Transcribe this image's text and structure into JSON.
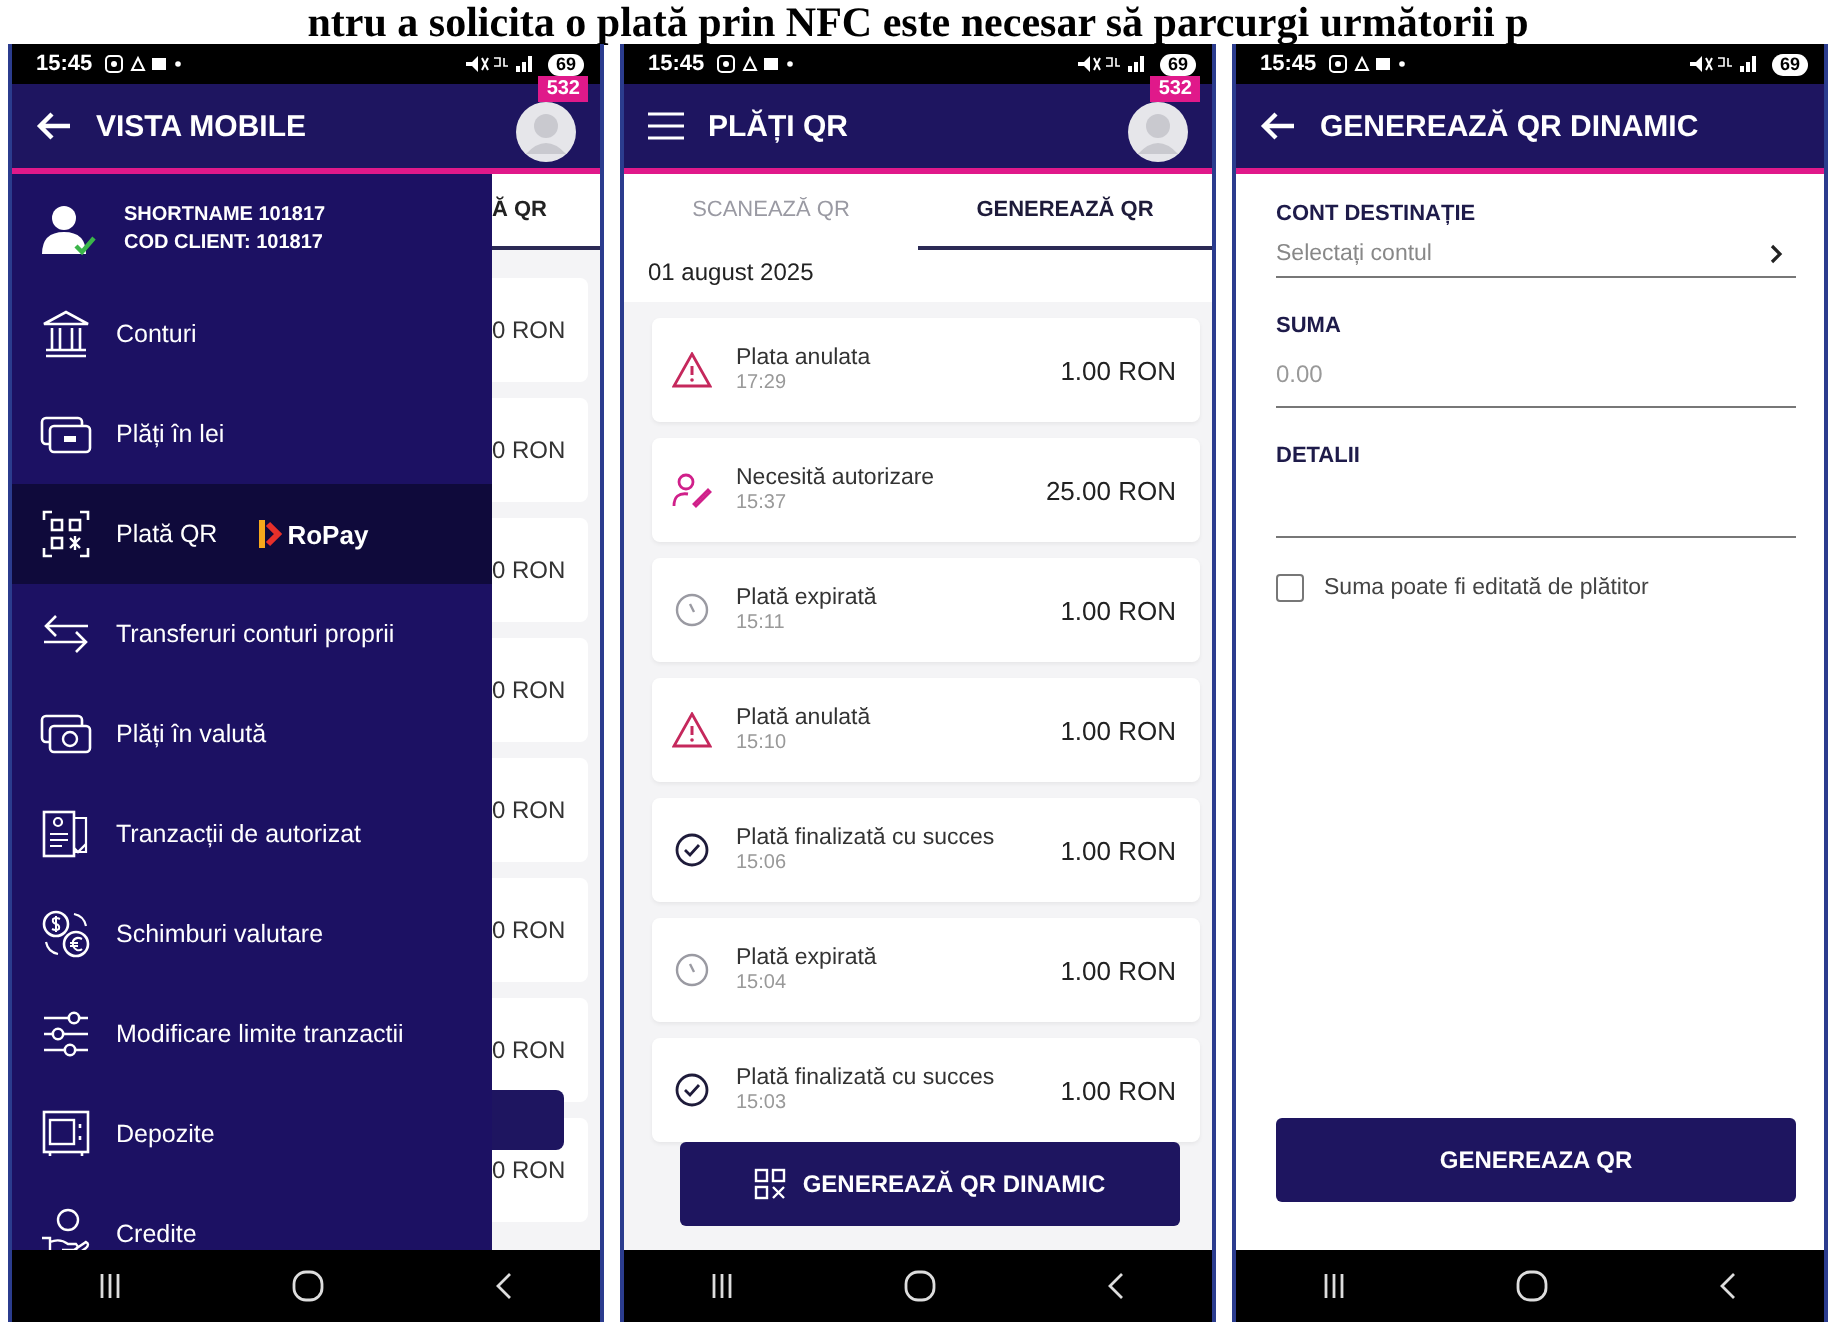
{
  "caption": "ntru a solicita o plată prin NFC este necesar să parcurgi următorii p",
  "screens": [
    {
      "kind": "drawer",
      "status_bar": {
        "time": "15:45",
        "battery": "69"
      },
      "header": {
        "kind": "back",
        "title": "VISTA MOBILE",
        "badge": "532"
      },
      "user": {
        "name": "SHORTNAME 101817",
        "client_code": "COD CLIENT: 101817"
      },
      "items": [
        {
          "kind": "bank",
          "label": "Conturi",
          "selected": false
        },
        {
          "kind": "cash",
          "label": "Plăți în lei",
          "selected": false
        },
        {
          "kind": "qr",
          "label": "Plată QR",
          "brand": "RoPay",
          "selected": true
        },
        {
          "kind": "transfer",
          "label": "Transferuri conturi proprii",
          "selected": false
        },
        {
          "kind": "currency",
          "label": "Plăți în valută",
          "selected": false
        },
        {
          "kind": "document",
          "label": "Tranzacții de autorizat",
          "selected": false
        },
        {
          "kind": "exchange",
          "label": "Schimburi valutare",
          "selected": false
        },
        {
          "kind": "sliders",
          "label": "Modificare limite tranzactii",
          "selected": false
        },
        {
          "kind": "safe",
          "label": "Depozite",
          "selected": false
        },
        {
          "kind": "hand",
          "label": "Credite",
          "selected": false
        }
      ],
      "background": {
        "tab": "Ă QR",
        "amounts": [
          "0 RON",
          "0 RON",
          "0 RON",
          "0 RON",
          "0 RON",
          "0 RON",
          "0 RON",
          "0 RON"
        ]
      }
    },
    {
      "kind": "list",
      "status_bar": {
        "time": "15:45",
        "battery": "69"
      },
      "header": {
        "kind": "menu",
        "title": "PLĂȚI QR",
        "badge": "532"
      },
      "tabs": [
        {
          "label": "SCANEAZĂ QR",
          "selected": false
        },
        {
          "label": "GENEREAZĂ QR",
          "selected": true
        }
      ],
      "date": "01 august 2025",
      "payments": [
        {
          "kind": "cancelled",
          "title": "Plata anulata",
          "time": "17:29",
          "amount": "1.00 RON"
        },
        {
          "kind": "authorization",
          "title": "Necesită autorizare",
          "time": "15:37",
          "amount": "25.00 RON"
        },
        {
          "kind": "expired",
          "title": "Plată expirată",
          "time": "15:11",
          "amount": "1.00 RON"
        },
        {
          "kind": "cancelled",
          "title": "Plată anulată",
          "time": "15:10",
          "amount": "1.00 RON"
        },
        {
          "kind": "success",
          "title": "Plată finalizată cu succes",
          "time": "15:06",
          "amount": "1.00 RON"
        },
        {
          "kind": "expired",
          "title": "Plată expirată",
          "time": "15:04",
          "amount": "1.00 RON"
        },
        {
          "kind": "success",
          "title": "Plată finalizată cu succes",
          "time": "15:03",
          "amount": "1.00 RON"
        }
      ],
      "button": "GENEREAZĂ QR DINAMIC"
    },
    {
      "kind": "form",
      "status_bar": {
        "time": "15:45",
        "battery": "69"
      },
      "header": {
        "kind": "back",
        "title": "GENEREAZĂ QR DINAMIC"
      },
      "fields": [
        {
          "kind": "select",
          "label": "CONT DESTINAȚIE",
          "placeholder": "Selectați contul"
        },
        {
          "kind": "input",
          "label": "SUMA",
          "placeholder": "0.00"
        },
        {
          "kind": "input",
          "label": "DETALII"
        }
      ],
      "checkbox": {
        "label": "Suma poate fi editată de plătitor",
        "checked": false
      },
      "button": "GENEREAZA QR"
    }
  ]
}
